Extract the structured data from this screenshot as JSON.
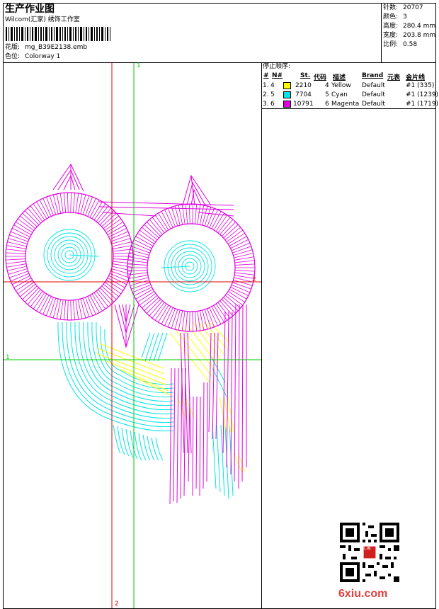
{
  "header": {
    "title": "生产作业图",
    "company": "Wilcom(汇家) 绣饰工作室",
    "design_label": "花版:",
    "design_file": "mg_B39E2138.emb",
    "colorway_label": "色位:",
    "colorway": "Colorway 1"
  },
  "stats": [
    {
      "label": "针数:",
      "value": "20707"
    },
    {
      "label": "颜色:",
      "value": "3"
    },
    {
      "label": "高度:",
      "value": "280.4 mm"
    },
    {
      "label": "宽度:",
      "value": "203.8 mm"
    },
    {
      "label": "比例:",
      "value": "0.58"
    }
  ],
  "stop_sequence": {
    "title": "停止顺序:",
    "headers": [
      "#",
      "N#",
      "St.",
      "代码",
      "描述",
      "Brand",
      "元表",
      "金片线"
    ],
    "rows": [
      {
        "num": "1.",
        "n": "4",
        "color": "#ffff00",
        "st": "2210",
        "code": "4",
        "desc": "Yellow",
        "brand": "Default",
        "sequin": "#1 (335)"
      },
      {
        "num": "2.",
        "n": "5",
        "color": "#00e5e5",
        "st": "7704",
        "code": "5",
        "desc": "Cyan",
        "brand": "Default",
        "sequin": "#1 (1239)"
      },
      {
        "num": "3.",
        "n": "6",
        "color": "#e000e0",
        "st": "10791",
        "code": "6",
        "desc": "Magenta",
        "brand": "Default",
        "sequin": "#1 (1719)"
      }
    ]
  },
  "guides": {
    "vertical_green_label": "1",
    "horizontal_red_label": "2",
    "horizontal_green_label": "1",
    "vertical_red_label": "2"
  },
  "colors": {
    "yellow": "#ffff00",
    "cyan": "#00e5e5",
    "magenta": "#e000e0",
    "guide_red": "#e00000",
    "guide_green": "#00cc00"
  },
  "watermark": {
    "site": "6xiu.com",
    "seal_text": "汇家"
  }
}
